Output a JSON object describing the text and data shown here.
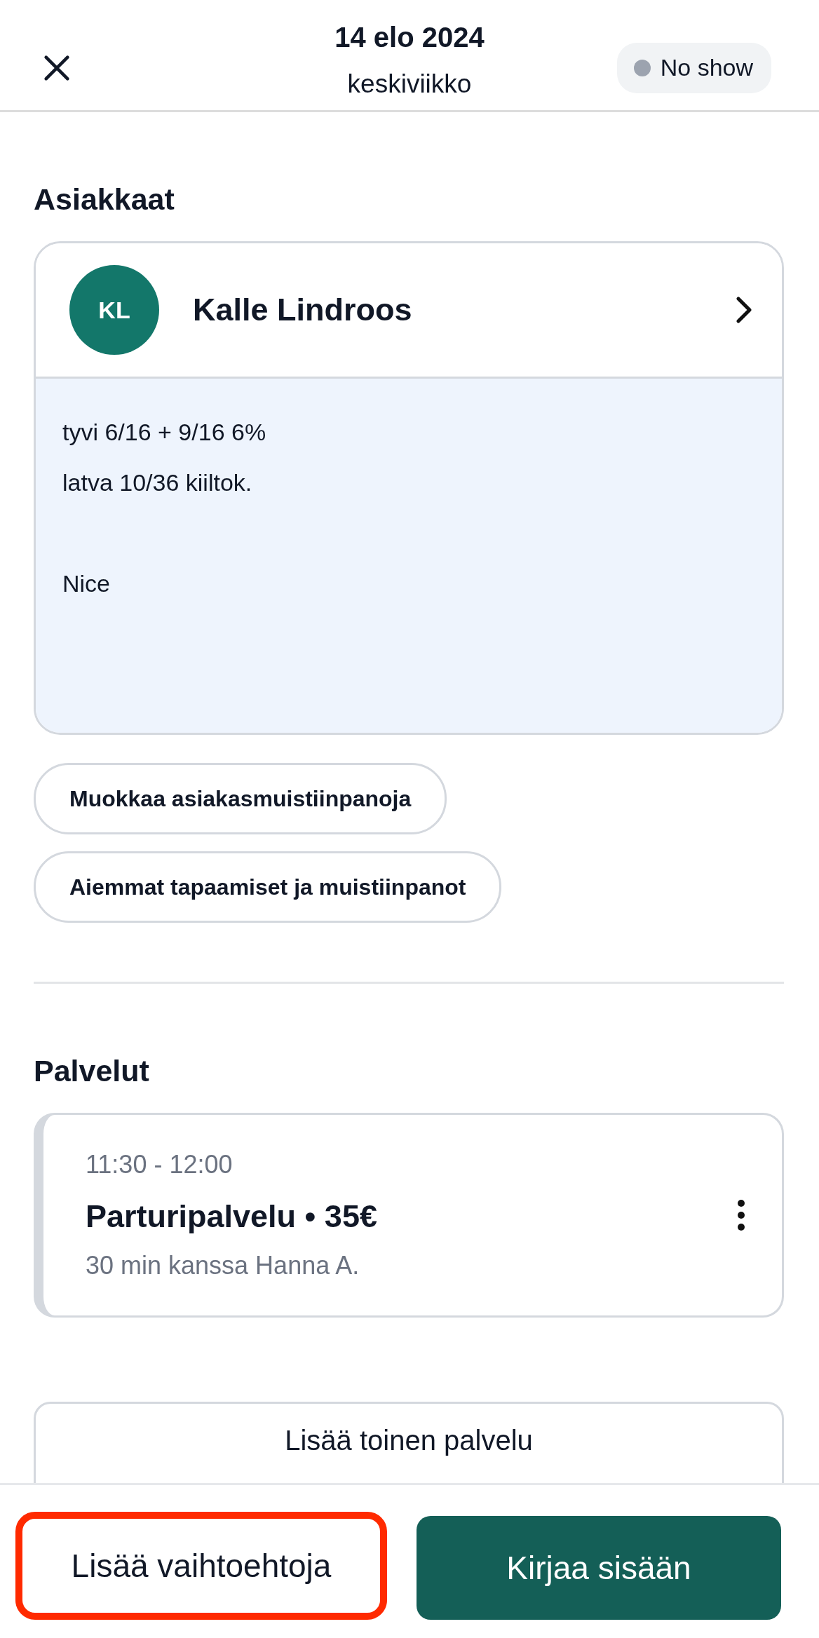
{
  "header": {
    "date": "14 elo 2024",
    "weekday": "keskiviikko",
    "status": {
      "label": "No show",
      "color": "#9ca3af"
    }
  },
  "clients": {
    "heading": "Asiakkaat",
    "client": {
      "initials": "KL",
      "name": "Kalle Lindroos",
      "notes": [
        [
          "tyvi 6/16 + 9/16 6%",
          "latva 10/36 kiiltok."
        ],
        [
          "Nice"
        ]
      ]
    },
    "actions": [
      "Muokkaa asiakasmuistiinpanoja",
      "Aiemmat tapaamiset ja muistiinpanot"
    ]
  },
  "services": {
    "heading": "Palvelut",
    "items": [
      {
        "time": "11:30 - 12:00",
        "title": "Parturipalvelu • 35€",
        "detail": "30 min kanssa Hanna A."
      }
    ],
    "add_label": "Lisää toinen palvelu"
  },
  "footer": {
    "buttons": [
      {
        "label": "Lisää vaihtoehtoja",
        "kind": "secondary",
        "highlighted": true
      },
      {
        "label": "Kirjaa sisään",
        "kind": "primary",
        "highlighted": false
      }
    ]
  }
}
